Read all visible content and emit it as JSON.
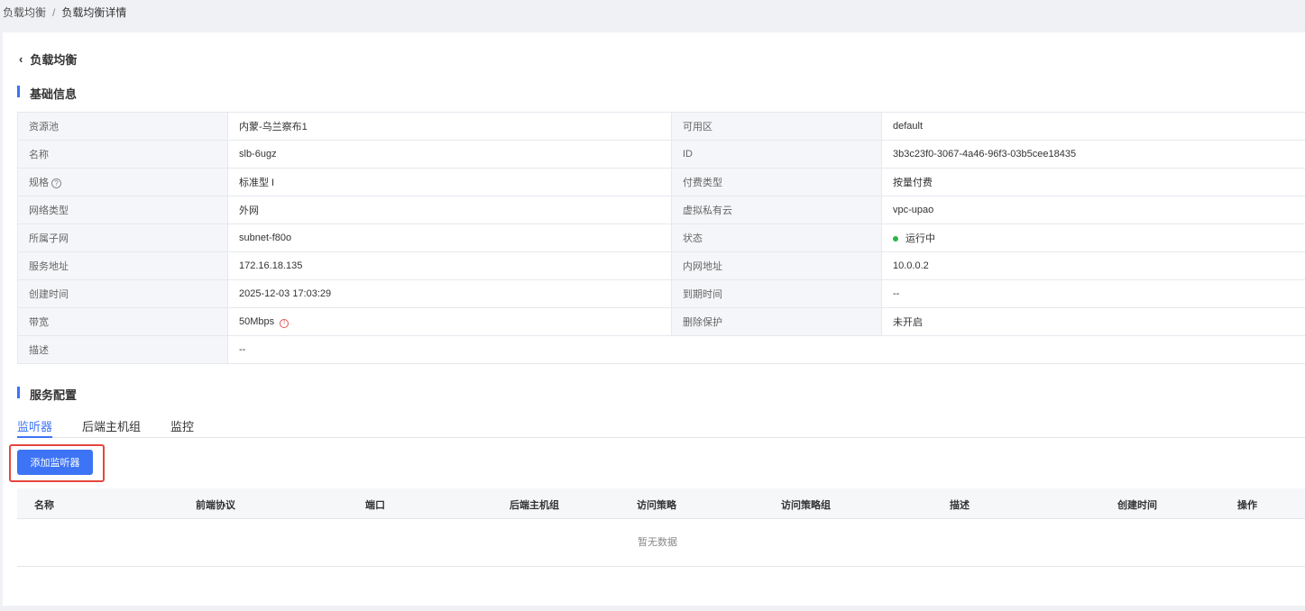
{
  "breadcrumb": {
    "parent": "负载均衡",
    "current": "负载均衡详情",
    "separator": "/"
  },
  "back_label": "负载均衡",
  "basic": {
    "title": "基础信息",
    "rows": [
      [
        {
          "label": "资源池",
          "value": "内蒙-乌兰察布1"
        },
        {
          "label": "可用区",
          "value": "default"
        }
      ],
      [
        {
          "label": "名称",
          "value": "slb-6ugz"
        },
        {
          "label": "ID",
          "value": "3b3c23f0-3067-4a46-96f3-03b5cee18435"
        }
      ],
      [
        {
          "label": "规格",
          "value": "标准型 I"
        },
        {
          "label": "付费类型",
          "value": "按量付费"
        }
      ],
      [
        {
          "label": "网络类型",
          "value": "外网"
        },
        {
          "label": "虚拟私有云",
          "value": "vpc-upao"
        }
      ],
      [
        {
          "label": "所属子网",
          "value": "subnet-f80o"
        },
        {
          "label": "状态",
          "value": "运行中"
        }
      ],
      [
        {
          "label": "服务地址",
          "value": "172.16.18.135"
        },
        {
          "label": "内网地址",
          "value": "10.0.0.2"
        }
      ],
      [
        {
          "label": "创建时间",
          "value": "2025-12-03 17:03:29"
        },
        {
          "label": "到期时间",
          "value": "--"
        }
      ],
      [
        {
          "label": "带宽",
          "value": "50Mbps"
        },
        {
          "label": "删除保护",
          "value": "未开启"
        }
      ],
      [
        {
          "label": "描述",
          "value": "--"
        }
      ]
    ]
  },
  "service": {
    "title": "服务配置",
    "tabs": [
      "监听器",
      "后端主机组",
      "监控"
    ],
    "add_button": "添加监听器",
    "columns": [
      "名称",
      "前端协议",
      "端口",
      "后端主机组",
      "访问策略",
      "访问策略组",
      "描述",
      "创建时间",
      "操作"
    ],
    "empty": "暂无数据"
  },
  "colors": {
    "accent": "#3d74f5",
    "status_running": "#2bb24c",
    "highlight": "#e5463e"
  }
}
